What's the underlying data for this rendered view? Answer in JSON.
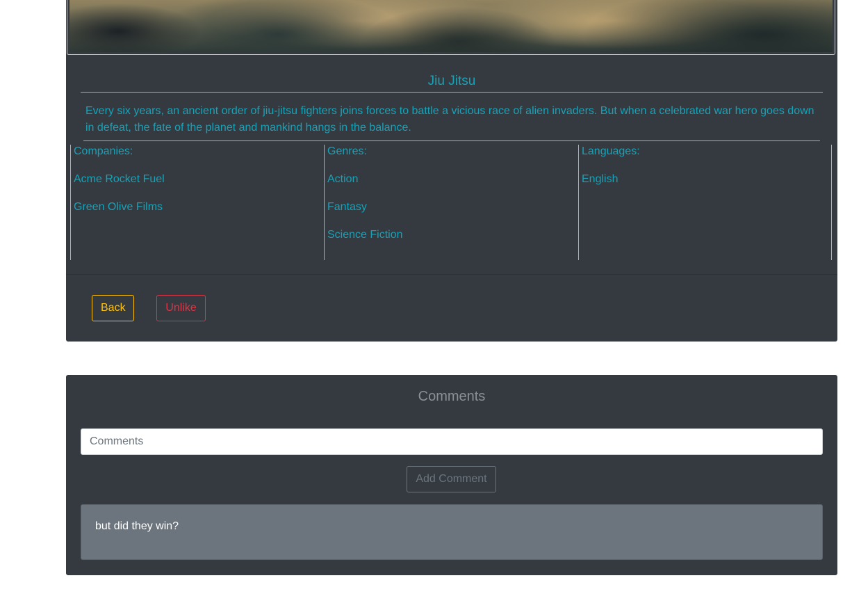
{
  "movie": {
    "title": "Jiu Jitsu",
    "description": "Every six years, an ancient order of jiu-jitsu fighters joins forces to battle a vicious race of alien invaders. But when a celebrated war hero goes down in defeat, the fate of the planet and mankind hangs in the balance.",
    "companies_label": "Companies:",
    "companies": [
      "Acme Rocket Fuel",
      "Green Olive Films"
    ],
    "genres_label": "Genres:",
    "genres": [
      "Action",
      "Fantasy",
      "Science Fiction"
    ],
    "languages_label": "Languages:",
    "languages": [
      "English"
    ]
  },
  "actions": {
    "back_label": "Back",
    "unlike_label": "Unlike"
  },
  "comments": {
    "heading": "Comments",
    "input_placeholder": "Comments",
    "input_value": "",
    "add_label": "Add Comment",
    "items": [
      {
        "text": "but did they win?"
      }
    ]
  },
  "colors": {
    "card_background": "#343a40",
    "text_info": "#17a2b8",
    "warning": "#ffc107",
    "danger": "#dc3545",
    "secondary": "#6c757d"
  }
}
